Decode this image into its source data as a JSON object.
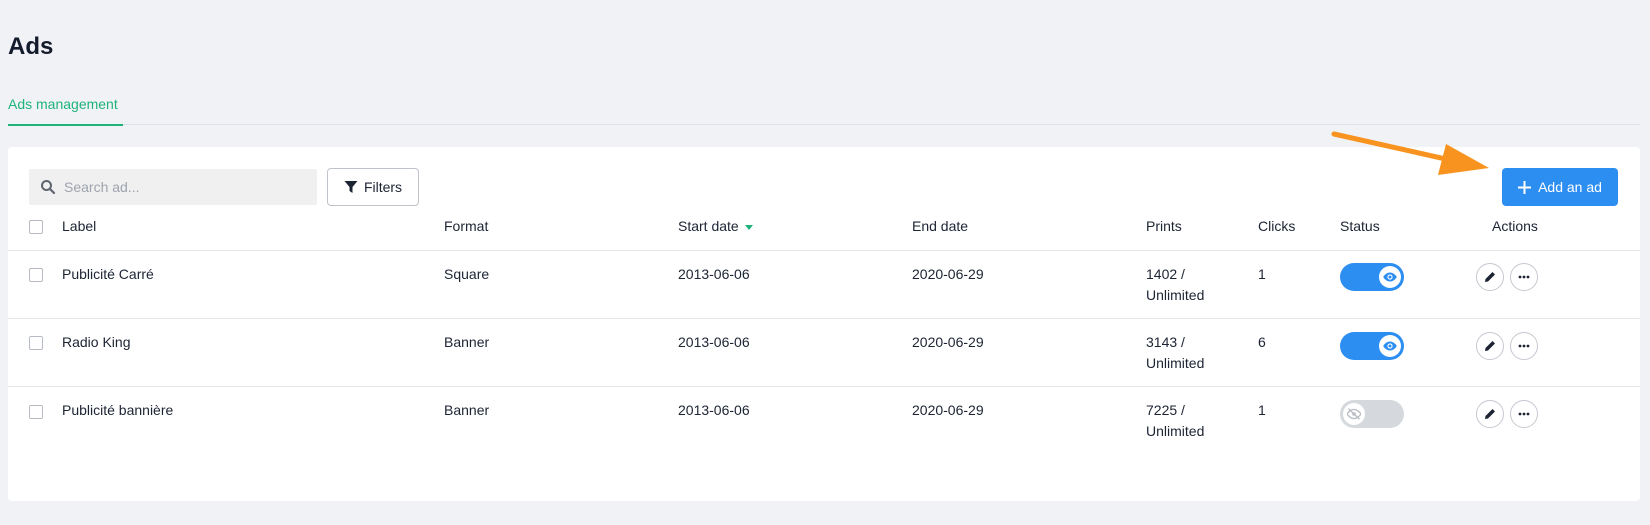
{
  "page": {
    "title": "Ads"
  },
  "tabs": [
    {
      "label": "Ads management",
      "active": true
    }
  ],
  "toolbar": {
    "search_placeholder": "Search ad...",
    "filters_label": "Filters",
    "add_label": "Add an ad"
  },
  "table": {
    "headers": {
      "label": "Label",
      "format": "Format",
      "start_date": "Start date",
      "end_date": "End date",
      "prints": "Prints",
      "clicks": "Clicks",
      "status": "Status",
      "actions": "Actions"
    },
    "sort": {
      "column": "start_date",
      "direction": "desc"
    },
    "rows": [
      {
        "label": "Publicité Carré",
        "format": "Square",
        "start_date": "2013-06-06",
        "end_date": "2020-06-29",
        "prints_count": "1402 /",
        "prints_limit": "Unlimited",
        "clicks": "1",
        "status": "visible"
      },
      {
        "label": "Radio King",
        "format": "Banner",
        "start_date": "2013-06-06",
        "end_date": "2020-06-29",
        "prints_count": "3143 /",
        "prints_limit": "Unlimited",
        "clicks": "6",
        "status": "visible"
      },
      {
        "label": "Publicité bannière",
        "format": "Banner",
        "start_date": "2013-06-06",
        "end_date": "2020-06-29",
        "prints_count": "7225 /",
        "prints_limit": "Unlimited",
        "clicks": "1",
        "status": "hidden"
      }
    ]
  },
  "colors": {
    "accent_green": "#1fb37a",
    "primary_blue": "#2d8ef2",
    "annotation_arrow": "#f7931e"
  },
  "icons": {
    "search": "search-icon",
    "filters": "filter-icon",
    "add": "plus-icon",
    "status_on": "eye-icon",
    "status_off": "eye-slash-icon",
    "edit": "pencil-icon",
    "more": "more-icon"
  }
}
